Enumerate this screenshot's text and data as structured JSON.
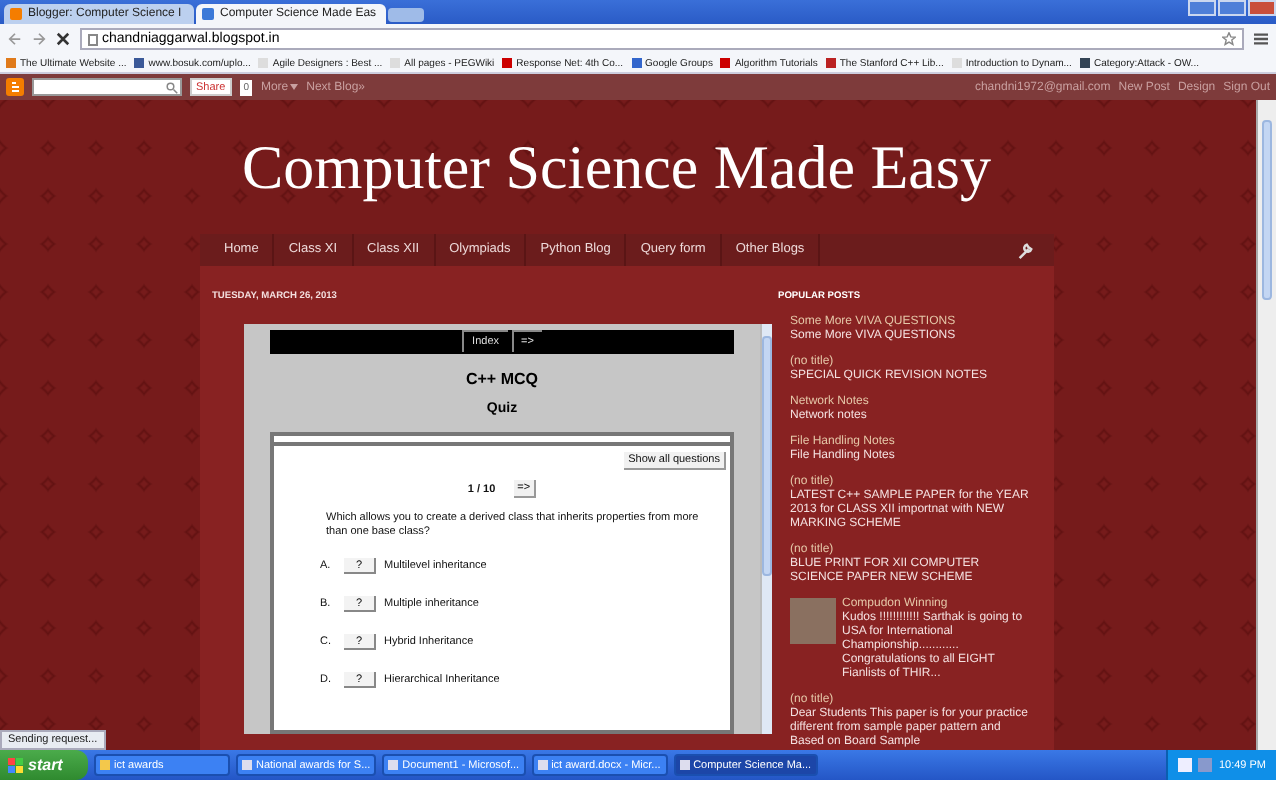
{
  "browser": {
    "tabs": [
      {
        "label": "Blogger: Computer Science I",
        "selected": false
      },
      {
        "label": "Computer Science Made Eas",
        "selected": true
      }
    ],
    "address": "chandniaggarwal.blogspot.in",
    "bookmarks": [
      "The Ultimate Website ...",
      "www.bosuk.com/uplo...",
      "Agile Designers : Best ...",
      "All pages - PEGWiki",
      "Response Net: 4th Co...",
      "Google Groups",
      "Algorithm Tutorials",
      "The Stanford C++ Lib...",
      "Introduction to Dynam...",
      "Category:Attack - OW..."
    ]
  },
  "blogger_bar": {
    "share": "Share",
    "share_count": "0",
    "more": "More",
    "next_blog": "Next Blog»",
    "email": "chandni1972@gmail.com",
    "links": [
      "New Post",
      "Design",
      "Sign Out"
    ]
  },
  "blog": {
    "title": "Computer Science Made Easy",
    "nav": [
      {
        "label": "Home",
        "selected": false
      },
      {
        "label": "Class XI",
        "selected": false
      },
      {
        "label": "Class XII",
        "selected": false
      },
      {
        "label": "Olympiads",
        "selected": false
      },
      {
        "label": "Python Blog",
        "selected": false
      },
      {
        "label": "Query form",
        "selected": false
      },
      {
        "label": "Other Blogs",
        "selected": false
      }
    ],
    "date": "TUESDAY, MARCH 26, 2013",
    "quiz": {
      "nav_buttons": [
        "Index",
        "=>"
      ],
      "title": "C++ MCQ",
      "subtitle": "Quiz",
      "show_all": "Show all questions",
      "counter": "1 / 10",
      "next": "=>",
      "question": "Which allows you to create a derived class that inherits properties from more than one base class?",
      "options": [
        {
          "letter": "A.",
          "button": "?",
          "text": "Multilevel inheritance"
        },
        {
          "letter": "B.",
          "button": "?",
          "text": "Multiple inheritance"
        },
        {
          "letter": "C.",
          "button": "?",
          "text": "Hybrid Inheritance"
        },
        {
          "letter": "D.",
          "button": "?",
          "text": "Hierarchical Inheritance"
        }
      ]
    }
  },
  "sidebar": {
    "heading": "POPULAR POSTS",
    "posts": [
      {
        "kind": "text",
        "title": "Some More VIVA QUESTIONS",
        "snippet": "Some More VIVA QUESTIONS"
      },
      {
        "kind": "text",
        "title": "(no title)",
        "snippet": "SPECIAL QUICK REVISION NOTES"
      },
      {
        "kind": "text",
        "title": "Network Notes",
        "snippet": "Network notes"
      },
      {
        "kind": "text",
        "title": "File Handling Notes",
        "snippet": "File Handling Notes"
      },
      {
        "kind": "text",
        "title": "(no title)",
        "snippet": "LATEST C++ SAMPLE PAPER for the YEAR 2013  for CLASS XII importnat with NEW MARKING SCHEME"
      },
      {
        "kind": "text",
        "title": "(no title)",
        "snippet": "BLUE PRINT FOR XII COMPUTER SCIENCE PAPER NEW SCHEME"
      },
      {
        "kind": "image",
        "title": "Compudon Winning",
        "snippet": "Kudos !!!!!!!!!!!! Sarthak is going to USA for International Championship............ Congratulations to all EIGHT Fianlists of THIR..."
      },
      {
        "kind": "text",
        "title": "(no title)",
        "snippet": "Dear Students This paper is for your practice different from sample paper pattern and Based on Board Sample"
      }
    ]
  },
  "status_text": "Sending request...",
  "taskbar": {
    "start": "start",
    "items": [
      {
        "label": "ict awards",
        "selected": false
      },
      {
        "label": "National awards for S...",
        "selected": false
      },
      {
        "label": "Document1 - Microsof...",
        "selected": false
      },
      {
        "label": "ict award.docx - Micr...",
        "selected": false
      },
      {
        "label": "Computer Science Ma...",
        "selected": true
      }
    ],
    "clock": "10:49 PM"
  }
}
